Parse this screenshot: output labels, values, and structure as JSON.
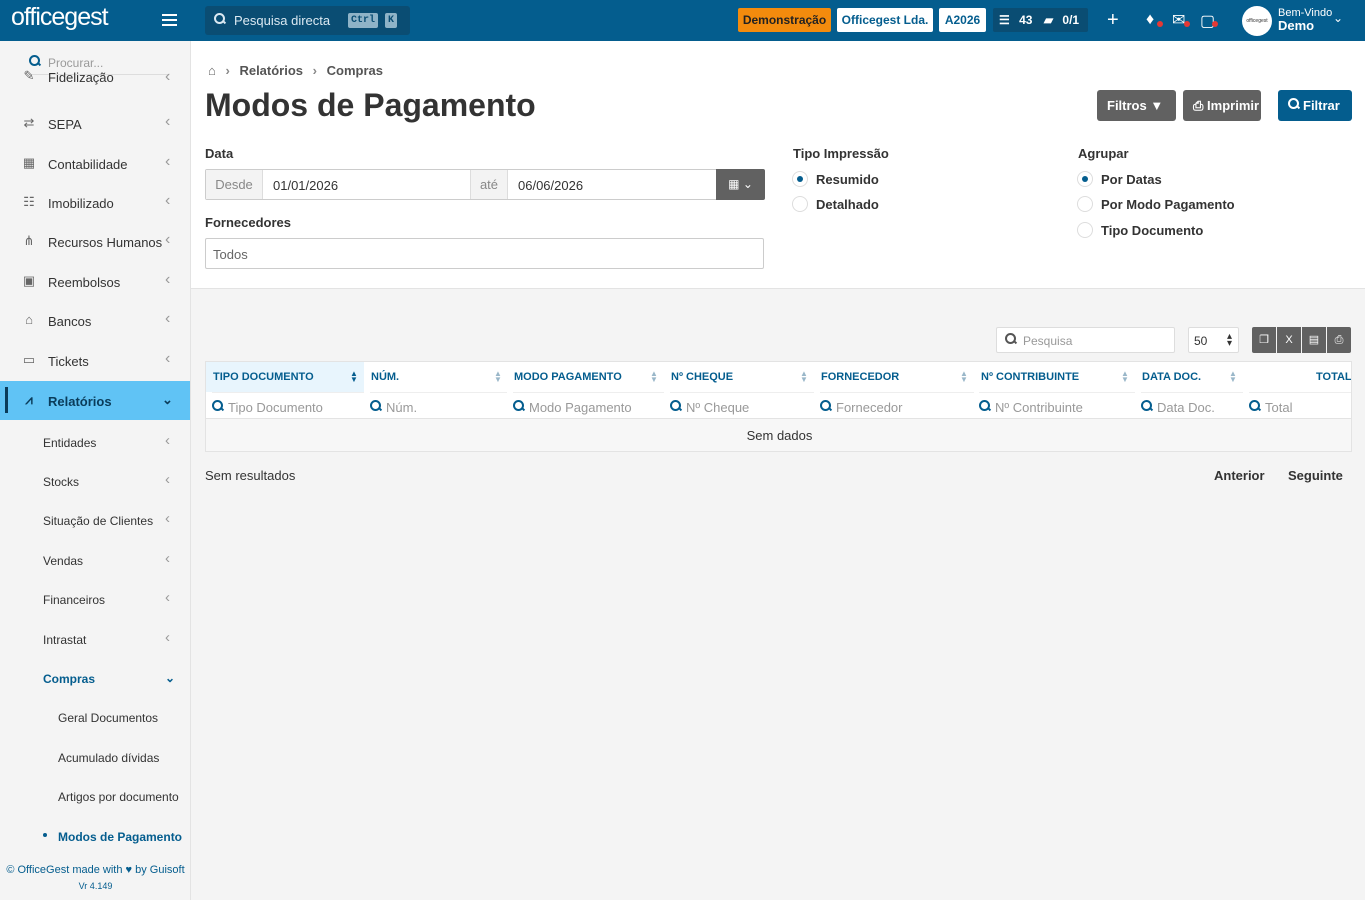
{
  "topbar": {
    "logo": "officegest",
    "search_placeholder": "Pesquisa directa",
    "kbd_ctrl": "Ctrl",
    "kbd_k": "K",
    "demo_label": "Demonstração",
    "company_label": "Officegest Lda.",
    "year_label": "A2026",
    "tasks_count": "43",
    "docs_count": "0/1",
    "welcome_text": "Bem-Vindo",
    "user_name": "Demo",
    "avatar_text": "officegest"
  },
  "sidebar": {
    "search_placeholder": "Procurar...",
    "items": [
      {
        "label": "Fidelização",
        "icon": "loyalty-icon"
      },
      {
        "label": "SEPA",
        "icon": "exchange-icon"
      },
      {
        "label": "Contabilidade",
        "icon": "calculator-icon"
      },
      {
        "label": "Imobilizado",
        "icon": "handshake-icon"
      },
      {
        "label": "Recursos Humanos",
        "icon": "sitemap-icon"
      },
      {
        "label": "Reembolsos",
        "icon": "money-icon"
      },
      {
        "label": "Bancos",
        "icon": "bank-icon"
      },
      {
        "label": "Tickets",
        "icon": "ticket-icon"
      },
      {
        "label": "Relatórios",
        "icon": "chart-icon"
      }
    ],
    "subitems": [
      "Entidades",
      "Stocks",
      "Situação de Clientes",
      "Vendas",
      "Financeiros",
      "Intrastat",
      "Compras"
    ],
    "compras_items": [
      "Geral Documentos",
      "Acumulado dívidas",
      "Artigos por documento",
      "Modos de Pagamento"
    ],
    "footer_line1": "© OfficeGest made with",
    "footer_by": "by Guisoft",
    "footer_version": "Vr 4.149"
  },
  "breadcrumb": {
    "level1": "Relatórios",
    "level2": "Compras"
  },
  "page_title": "Modos de Pagamento",
  "buttons": {
    "filtros": "Filtros",
    "imprimir": "Imprimir",
    "filtrar": "Filtrar"
  },
  "form": {
    "date_label": "Data",
    "from_label": "Desde",
    "from_value": "01/01/2026",
    "to_label": "até",
    "to_value": "06/06/2026",
    "suppliers_label": "Fornecedores",
    "suppliers_value": "Todos",
    "print_type_label": "Tipo Impressão",
    "print_options": [
      "Resumido",
      "Detalhado"
    ],
    "print_selected": "Resumido",
    "group_label": "Agrupar",
    "group_options": [
      "Por Datas",
      "Por Modo Pagamento",
      "Tipo Documento"
    ],
    "group_selected": "Por Datas"
  },
  "table": {
    "search_placeholder": "Pesquisa",
    "page_size": "50",
    "columns": [
      "TIPO DOCUMENTO",
      "NÚM.",
      "MODO PAGAMENTO",
      "Nº CHEQUE",
      "FORNECEDOR",
      "Nº CONTRIBUINTE",
      "DATA DOC.",
      "TOTAL"
    ],
    "filters": [
      "Tipo Documento",
      "Núm.",
      "Modo Pagamento",
      "Nº Cheque",
      "Fornecedor",
      "Nº Contribuinte",
      "Data Doc.",
      "Total"
    ],
    "empty_text": "Sem dados"
  },
  "results_text": "Sem resultados",
  "pagination": {
    "previous": "Anterior",
    "next": "Seguinte"
  },
  "colors": {
    "primary": "#045d8e",
    "accent_orange": "#f38b0d",
    "active_nav": "#60c3f5"
  }
}
